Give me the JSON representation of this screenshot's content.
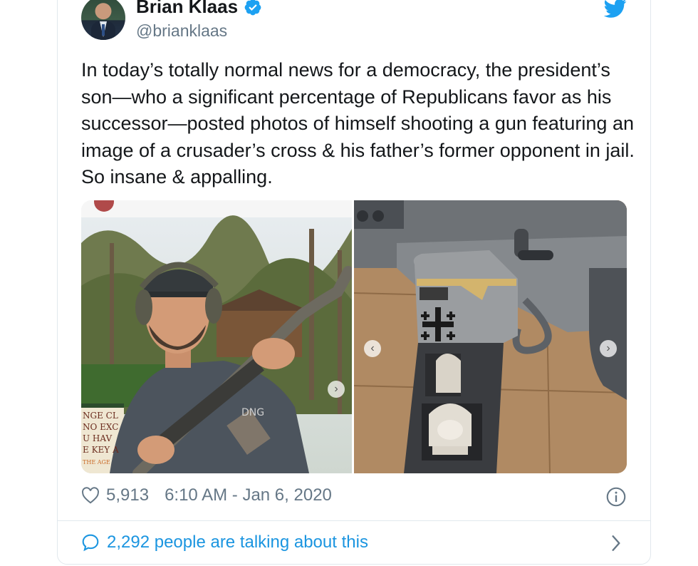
{
  "author": {
    "name": "Brian Klaas",
    "handle": "@brianklaas",
    "verified_icon": "verified-badge-icon",
    "avatar_icon": "profile-avatar"
  },
  "tweet": {
    "text": "In today’s totally normal news for a democracy, the president’s son—who a significant percentage of Republicans favor as his successor—posted photos of himself shooting a gun featuring an image of a crusader’s cross & his father’s former opponent in jail. So insane & appalling."
  },
  "media": {
    "left_sign_lines": [
      "NGE CL",
      "NO EXC",
      "U HAV",
      "E KEY A",
      "THE AGE"
    ],
    "left_shirt_text": "DNG"
  },
  "footer": {
    "likes": "5,913",
    "timestamp": "6:10 AM - Jan 6, 2020",
    "talking": "2,292 people are talking about this"
  },
  "colors": {
    "accent": "#1b95e0",
    "muted": "#657786",
    "text": "#14171a",
    "border": "#e1e8ed"
  }
}
